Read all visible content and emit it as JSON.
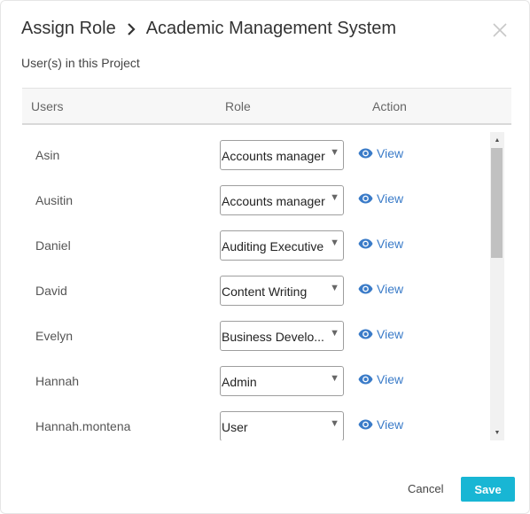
{
  "dialog": {
    "title": "Assign Role",
    "project": "Academic Management System",
    "subtitle": "User(s) in this Project"
  },
  "table": {
    "headers": {
      "users": "Users",
      "role": "Role",
      "action": "Action"
    },
    "rows": [
      {
        "user": "Asin",
        "role": "Accounts manager",
        "action": "View"
      },
      {
        "user": "Ausitin",
        "role": "Accounts manager",
        "action": "View"
      },
      {
        "user": "Daniel",
        "role": "Auditing Executive",
        "action": "View"
      },
      {
        "user": "David",
        "role": "Content Writing",
        "action": "View"
      },
      {
        "user": "Evelyn",
        "role": "Business Develo...",
        "action": "View"
      },
      {
        "user": "Hannah",
        "role": "Admin",
        "action": "View"
      },
      {
        "user": "Hannah.montena",
        "role": "User",
        "action": "View"
      }
    ]
  },
  "footer": {
    "cancel": "Cancel",
    "save": "Save"
  },
  "colors": {
    "accent": "#18b6d4",
    "link": "#3a7bc8"
  },
  "icons": {
    "breadcrumb": "chevron-right-icon",
    "close": "close-icon",
    "view": "eye-icon",
    "dropdown": "caret-down-icon"
  }
}
